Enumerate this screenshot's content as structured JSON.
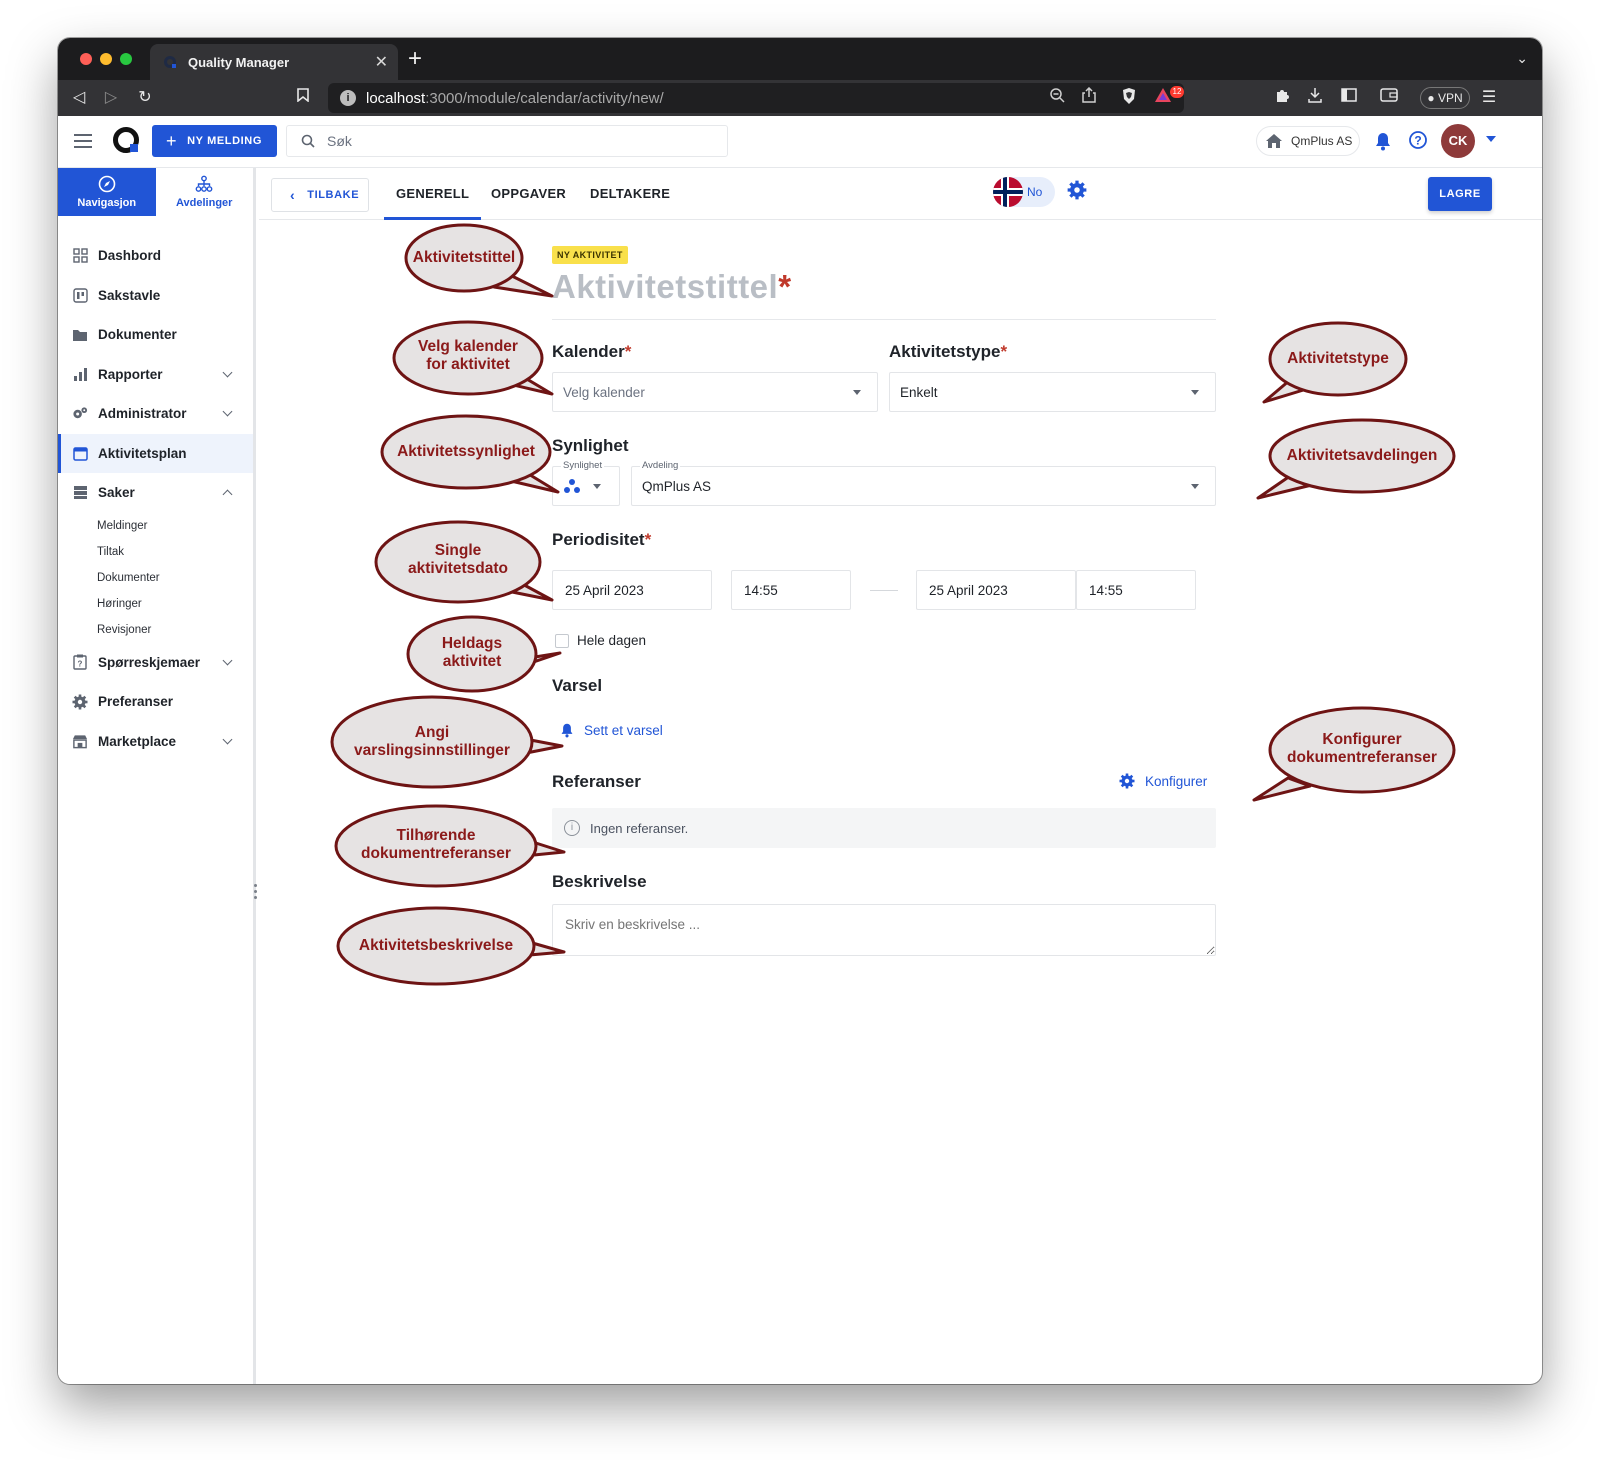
{
  "browser": {
    "tab_title": "Quality Manager",
    "url_host": "localhost",
    "url_path": ":3000/module/calendar/activity/new/",
    "vpn_label": "VPN",
    "extension_badge": "12"
  },
  "header": {
    "new_message_label": "NY MELDING",
    "search_placeholder": "Søk",
    "org_name": "QmPlus AS",
    "avatar_initials": "CK",
    "accent_color": "#2155d6"
  },
  "sidebar": {
    "tabs": [
      {
        "label": "Navigasjon",
        "icon": "compass-icon",
        "active": true
      },
      {
        "label": "Avdelinger",
        "icon": "org-chart-icon",
        "active": false
      }
    ],
    "items": [
      {
        "label": "Dashbord",
        "icon": "grid-icon"
      },
      {
        "label": "Sakstavle",
        "icon": "board-icon"
      },
      {
        "label": "Dokumenter",
        "icon": "folder-icon"
      },
      {
        "label": "Rapporter",
        "icon": "bar-chart-icon",
        "expandable": true
      },
      {
        "label": "Administrator",
        "icon": "cogs-icon",
        "expandable": true
      },
      {
        "label": "Aktivitetsplan",
        "icon": "calendar-icon",
        "active": true
      },
      {
        "label": "Saker",
        "icon": "inbox-icon",
        "expandable": true,
        "expanded": true
      },
      {
        "label": "Spørreskjemaer",
        "icon": "clipboard-icon",
        "expandable": true
      },
      {
        "label": "Preferanser",
        "icon": "gear-icon"
      },
      {
        "label": "Marketplace",
        "icon": "store-icon",
        "expandable": true
      }
    ],
    "saker_subitems": [
      "Meldinger",
      "Tiltak",
      "Dokumenter",
      "Høringer",
      "Revisjoner"
    ]
  },
  "content_bar": {
    "back_label": "TILBAKE",
    "tabs": [
      {
        "label": "GENERELL",
        "active": true
      },
      {
        "label": "OPPGAVER",
        "active": false
      },
      {
        "label": "DELTAKERE",
        "active": false
      }
    ],
    "language": "No",
    "save_label": "LAGRE"
  },
  "form": {
    "badge": "NY AKTIVITET",
    "title_placeholder": "Aktivitetstittel",
    "required_mark": "*",
    "calendar_label": "Kalender",
    "calendar_placeholder": "Velg kalender",
    "activity_type_label": "Aktivitetstype",
    "activity_type_value": "Enkelt",
    "visibility_section": "Synlighet",
    "visibility_mini_label": "Synlighet",
    "department_mini_label": "Avdeling",
    "department_value": "QmPlus AS",
    "periodicity_label": "Periodisitet",
    "start_date": "25 April 2023",
    "start_time": "14:55",
    "end_date": "25 April 2023",
    "end_time": "14:55",
    "all_day_label": "Hele dagen",
    "alert_section": "Varsel",
    "alert_link": "Sett et varsel",
    "references_section": "Referanser",
    "configure_label": "Konfigurer",
    "no_references": "Ingen referanser.",
    "description_section": "Beskrivelse",
    "description_placeholder": "Skriv en beskrivelse ..."
  },
  "callouts": {
    "title": "Aktivitetstittel",
    "calendar_l1": "Velg kalender",
    "calendar_l2": "for aktivitet",
    "activity_type": "Aktivitetstype",
    "visibility": "Aktivitetssynlighet",
    "department": "Aktivitetsavdelingen",
    "single_l1": "Single",
    "single_l2": "aktivitetsdato",
    "allday_l1": "Heldags",
    "allday_l2": "aktivitet",
    "alert_l1": "Angi",
    "alert_l2": "varslingsinnstillinger",
    "configure_l1": "Konfigurer",
    "configure_l2": "dokumentreferanser",
    "refs_l1": "Tilhørende",
    "refs_l2": "dokumentreferanser",
    "description": "Aktivitetsbeskrivelse"
  }
}
